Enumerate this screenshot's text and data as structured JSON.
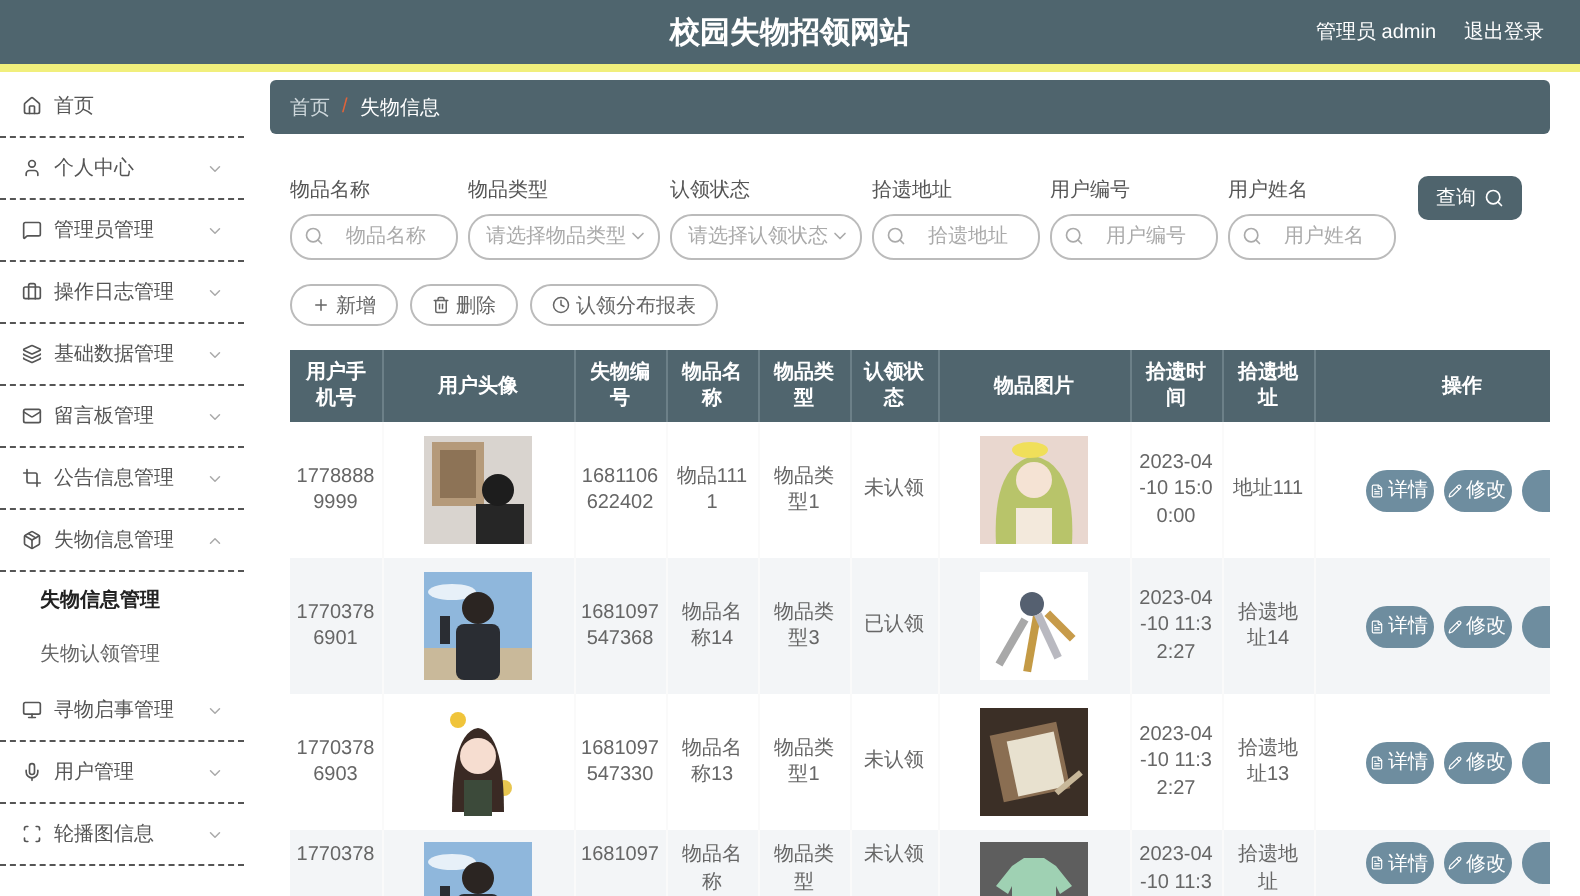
{
  "header": {
    "title": "校园失物招领网站",
    "user": "管理员 admin",
    "logout": "退出登录"
  },
  "sidebar": {
    "items": [
      {
        "label": "首页",
        "kind": "link"
      },
      {
        "label": "个人中心",
        "kind": "menu",
        "expanded": false
      },
      {
        "label": "管理员管理",
        "kind": "menu",
        "expanded": false
      },
      {
        "label": "操作日志管理",
        "kind": "menu",
        "expanded": false
      },
      {
        "label": "基础数据管理",
        "kind": "menu",
        "expanded": false
      },
      {
        "label": "留言板管理",
        "kind": "menu",
        "expanded": false
      },
      {
        "label": "公告信息管理",
        "kind": "menu",
        "expanded": false
      },
      {
        "label": "失物信息管理",
        "kind": "menu",
        "expanded": true,
        "children": [
          {
            "label": "失物信息管理",
            "selected": true
          },
          {
            "label": "失物认领管理",
            "selected": false
          }
        ]
      },
      {
        "label": "寻物启事管理",
        "kind": "menu",
        "expanded": false
      },
      {
        "label": "用户管理",
        "kind": "menu",
        "expanded": false
      },
      {
        "label": "轮播图信息",
        "kind": "menu",
        "expanded": false
      }
    ]
  },
  "breadcrumb": {
    "items": [
      "首页",
      "失物信息"
    ],
    "separator": "/"
  },
  "filters": [
    {
      "label": "物品名称",
      "kind": "search",
      "placeholder": "物品名称"
    },
    {
      "label": "物品类型",
      "kind": "select",
      "placeholder": "请选择物品类型"
    },
    {
      "label": "认领状态",
      "kind": "select",
      "placeholder": "请选择认领状态"
    },
    {
      "label": "拾遗地址",
      "kind": "search",
      "placeholder": "拾遗地址"
    },
    {
      "label": "用户编号",
      "kind": "search",
      "placeholder": "用户编号"
    },
    {
      "label": "用户姓名",
      "kind": "search",
      "placeholder": "用户姓名"
    }
  ],
  "query_button": "查询",
  "toolbar": [
    {
      "label": "新增",
      "kind": "add"
    },
    {
      "label": "删除",
      "kind": "delete"
    },
    {
      "label": "认领分布报表",
      "kind": "report"
    }
  ],
  "table": {
    "columns": [
      "用户手机号",
      "用户头像",
      "失物编号",
      "物品名称",
      "物品类型",
      "认领状态",
      "物品图片",
      "拾遗时间",
      "拾遗地址",
      "操作"
    ],
    "rows": [
      {
        "phone": "17788889999",
        "avatar": {
          "kind": "picture"
        },
        "code": "1681106622402",
        "name": "物品1111",
        "type": "物品类型1",
        "status": "未认领",
        "image": {
          "kind": "picture"
        },
        "time": "2023-04-10 15:00:00",
        "address": "地址111",
        "actions": [
          "详情",
          "修改"
        ]
      },
      {
        "phone": "17703786901",
        "avatar": {
          "kind": "picture"
        },
        "code": "1681097547368",
        "name": "物品名称14",
        "type": "物品类型3",
        "status": "已认领",
        "image": {
          "kind": "picture"
        },
        "time": "2023-04-10 11:32:27",
        "address": "拾遗地址14",
        "actions": [
          "详情",
          "修改"
        ]
      },
      {
        "phone": "17703786903",
        "avatar": {
          "kind": "picture"
        },
        "code": "1681097547330",
        "name": "物品名称13",
        "type": "物品类型1",
        "status": "未认领",
        "image": {
          "kind": "picture"
        },
        "time": "2023-04-10 11:32:27",
        "address": "拾遗地址13",
        "actions": [
          "详情",
          "修改"
        ]
      },
      {
        "phone": "1770378",
        "avatar": {
          "kind": "picture"
        },
        "code": "1681097",
        "name": "物品名称",
        "type": "物品类型",
        "status": "未认领",
        "image": {
          "kind": "picture"
        },
        "time": "2023-04-10 11:3",
        "address": "拾遗地址",
        "actions": [
          "详情",
          "修改"
        ]
      }
    ]
  }
}
